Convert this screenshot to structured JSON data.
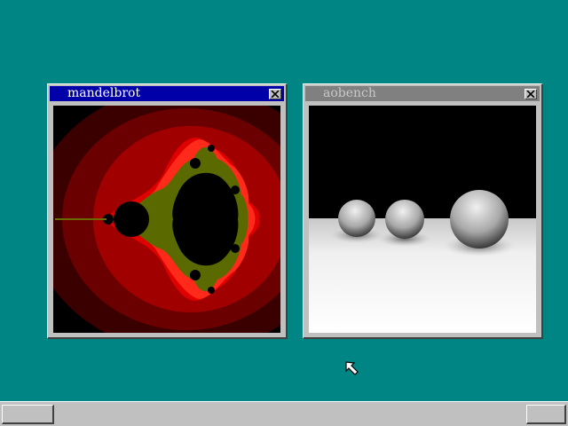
{
  "desktop": {
    "background_color": "#008585"
  },
  "windows": [
    {
      "title": "mandelbrot",
      "state": "active",
      "close_icon": "close-x-icon",
      "content": "mandelbrot-set-fractal-render"
    },
    {
      "title": "aobench",
      "state": "inactive",
      "close_icon": "close-x-icon",
      "content": "ambient-occlusion-spheres-render"
    }
  ],
  "taskbar": {
    "left_button_label": "",
    "right_button_label": ""
  },
  "cursor": {
    "icon": "arrow-cursor-icon"
  },
  "colors": {
    "active_title": "#0000a8",
    "inactive_title": "#808080",
    "chrome": "#c0c0c0"
  }
}
